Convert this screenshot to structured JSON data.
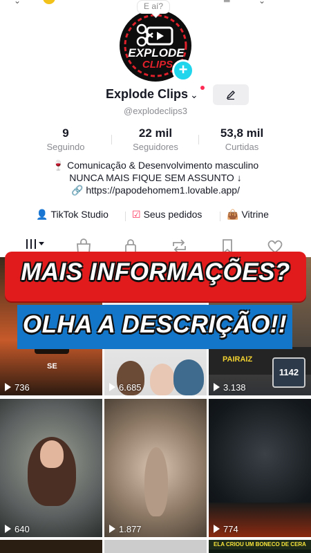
{
  "profile": {
    "bubble": "E aí?",
    "name": "Explode Clips",
    "handle": "@explodeclips3",
    "logo_line1": "EXPLODE",
    "logo_line2": "CLIPS"
  },
  "stats": [
    {
      "value": "9",
      "label": "Seguindo"
    },
    {
      "value": "22 mil",
      "label": "Seguidores"
    },
    {
      "value": "53,8 mil",
      "label": "Curtidas"
    }
  ],
  "bio": {
    "line1": "Comunicação & Desenvolvimento masculino",
    "line2": "NUNCA MAIS FIQUE SEM ASSUNTO ↓",
    "link": "https://papodehomem1.lovable.app/"
  },
  "shortcuts": [
    {
      "label": "TikTok Studio",
      "icon": "user-plus-icon"
    },
    {
      "label": "Seus pedidos",
      "icon": "orders-icon"
    },
    {
      "label": "Vitrine",
      "icon": "bag-icon"
    }
  ],
  "tabs": [
    "grid-icon",
    "shop-icon",
    "lock-icon",
    "repost-icon",
    "bookmark-icon",
    "heart-icon"
  ],
  "videos": [
    {
      "views": "736",
      "overlay": "SE"
    },
    {
      "views": "6.685",
      "overlay": ""
    },
    {
      "views": "3.138",
      "overlay": "PAIRAIZ"
    },
    {
      "views": "640",
      "overlay": ""
    },
    {
      "views": "1.877",
      "overlay": ""
    },
    {
      "views": "774",
      "overlay": ""
    }
  ],
  "bottom_strip": "ELA CRIOU UM BONECO DE CERA",
  "card_number": "1142",
  "banners": {
    "top": "MAIS INFORMAÇÕES?",
    "bottom": "OLHA A DESCRIÇÃO!!"
  },
  "colors": {
    "accent": "#fe2c55",
    "plus": "#20d5ec",
    "banner_red": "#e11b1b",
    "banner_blue": "#1376c9"
  }
}
